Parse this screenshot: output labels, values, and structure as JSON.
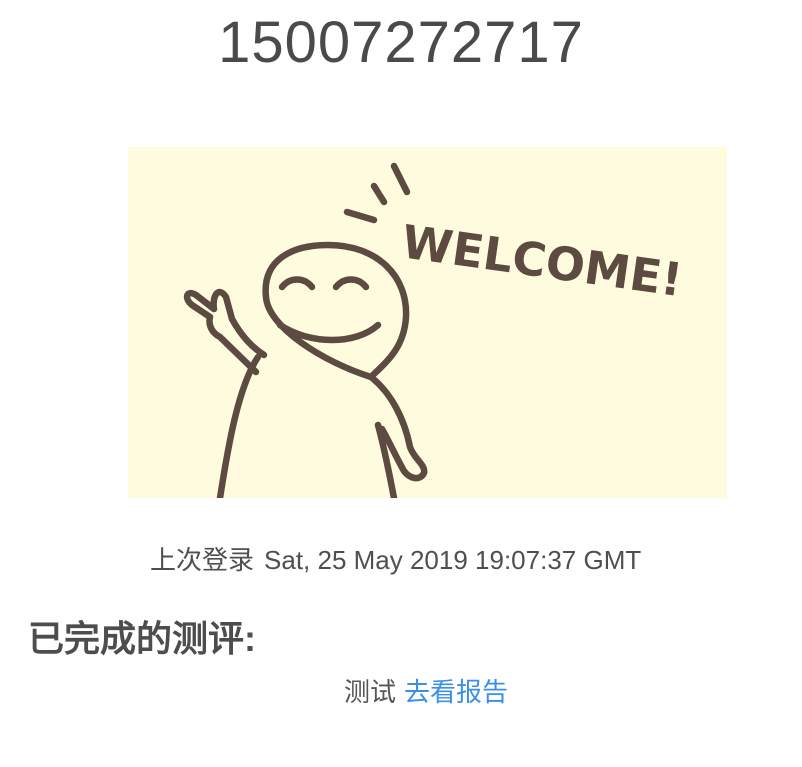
{
  "profile": {
    "phone": "15007272717"
  },
  "banner": {
    "text": "WELCOME!",
    "background": "#fffbdf",
    "stroke_color": "#5d4b41"
  },
  "login": {
    "label": "上次登录",
    "timestamp": "Sat, 25 May 2019 19:07:37 GMT"
  },
  "completed": {
    "heading": "已完成的测评:",
    "items": [
      {
        "name": "测试",
        "link_label": "去看报告",
        "link_color": "#3b8fe9"
      }
    ]
  }
}
